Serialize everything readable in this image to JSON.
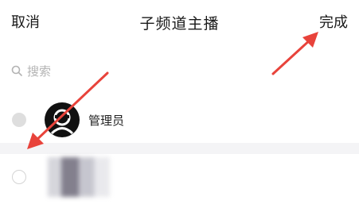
{
  "nav": {
    "cancel_label": "取消",
    "title": "子频道主播",
    "done_label": "完成"
  },
  "search": {
    "placeholder": "搜索",
    "icon": "search-icon"
  },
  "members": [
    {
      "name": "管理员",
      "selected": true,
      "avatar": "admin-avatar-icon"
    },
    {
      "name": "",
      "selected": false,
      "avatar": "blurred-avatar"
    }
  ],
  "colors": {
    "annotation_arrow": "#e8433b",
    "admin_avatar_bg": "#111111",
    "divider": "#f4f4f6"
  }
}
